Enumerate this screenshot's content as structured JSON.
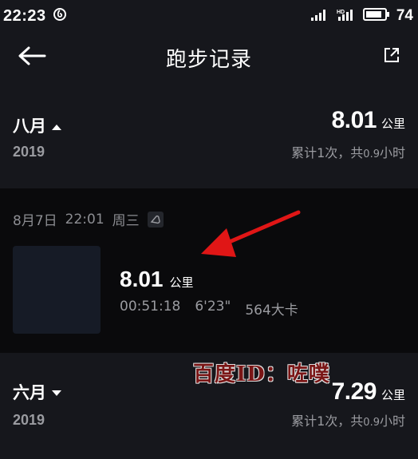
{
  "status_bar": {
    "time": "22:23",
    "battery": "74"
  },
  "header": {
    "title": "跑步记录",
    "back_icon": "back-arrow-icon",
    "share_icon": "share-icon"
  },
  "months": [
    {
      "name": "八月",
      "expanded": true,
      "year": "2019",
      "distance": "8.01",
      "unit": "公里",
      "summary_prefix": "累计1次，共",
      "summary_hours": "0.9",
      "summary_suffix": "小时"
    },
    {
      "name": "六月",
      "expanded": false,
      "year": "2019",
      "distance": "7.29",
      "unit": "公里",
      "summary_prefix": "累计1次，共",
      "summary_hours": "0.9",
      "summary_suffix": "小时"
    }
  ],
  "run": {
    "date": "8月7日",
    "time": "22:01",
    "weekday": "周三",
    "distance": "8.01",
    "unit": "公里",
    "duration": "00:51:18",
    "pace": "6'23\"",
    "calories": "564大卡"
  },
  "watermark": "百度ID：咗噗",
  "colors": {
    "background": "#16171c",
    "card_background": "#0a0a0c",
    "secondary_text": "#9a9ba0",
    "annotation_arrow": "#e01616"
  }
}
